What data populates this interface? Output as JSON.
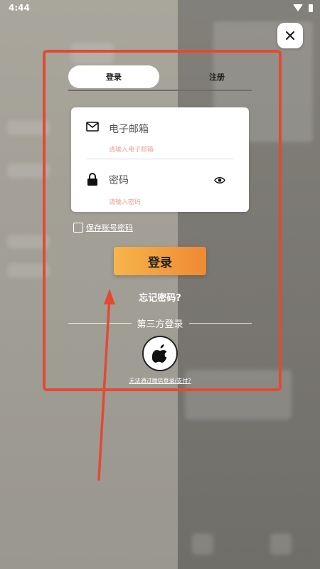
{
  "status_bar": {
    "time": "4:44"
  },
  "tabs": {
    "login": "登录",
    "register": "注册"
  },
  "email": {
    "label": "电子邮箱",
    "placeholder": "请输入电子邮箱"
  },
  "password": {
    "label": "密码",
    "placeholder": "请输入密码"
  },
  "remember": {
    "label": "保存账号密码",
    "checked": false
  },
  "login_button": {
    "label": "登录"
  },
  "forgot_link": "忘记密码?",
  "third_party": {
    "label": "第三方登录",
    "apple_icon": "apple-icon"
  },
  "wechat_link": "无法通过微信登录/支付?",
  "colors": {
    "accent_start": "#f6b54a",
    "accent_end": "#ef8a33",
    "highlight": "#e24a33",
    "hint": "#e8a19c"
  }
}
